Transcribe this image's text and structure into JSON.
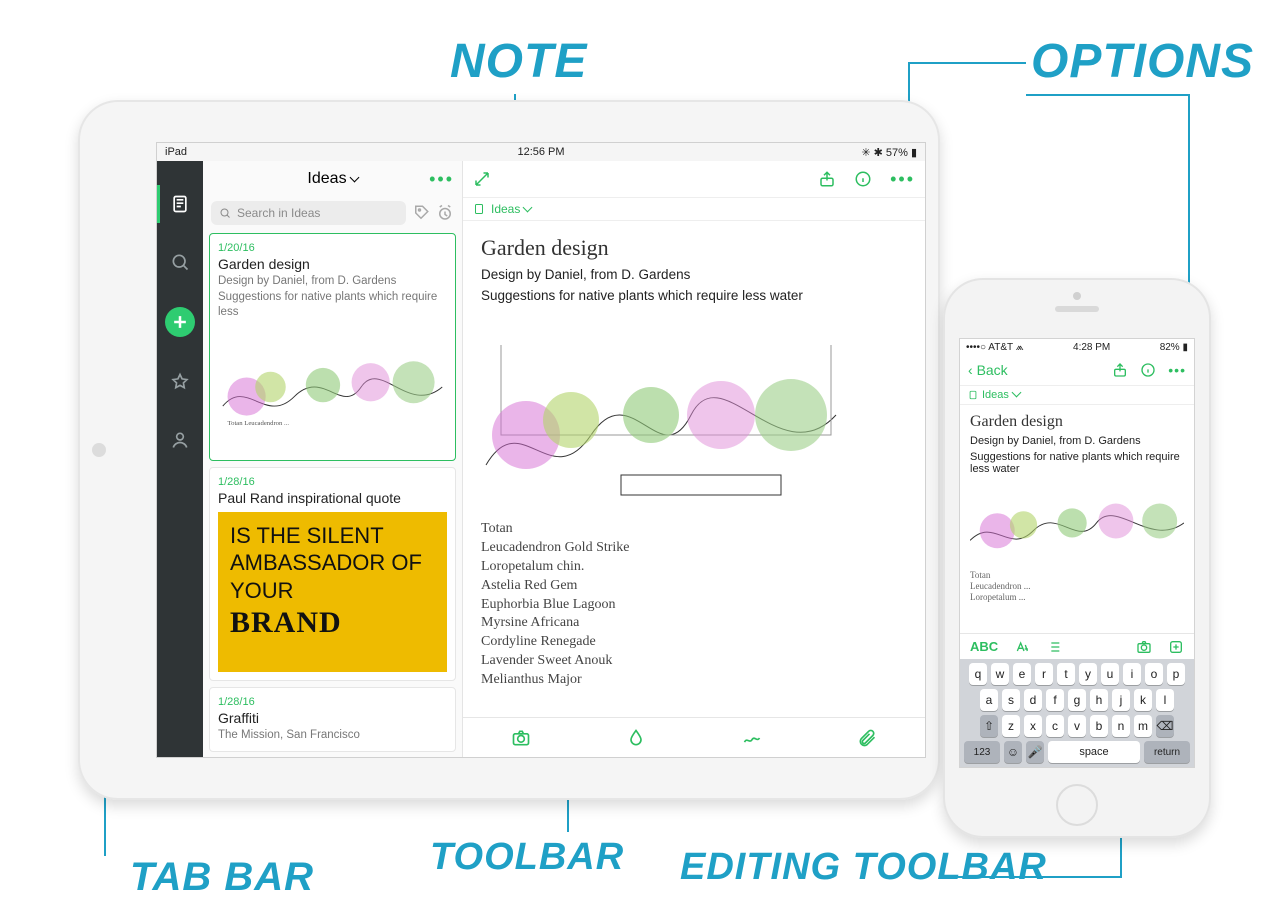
{
  "annotations": {
    "note": "NOTE",
    "options": "OPTIONS",
    "toolbar": "TOOLBAR",
    "editing_toolbar": "EDITING TOOLBAR",
    "tab_bar": "TAB BAR"
  },
  "accent_green": "#2dbe60",
  "accent_blue": "#1fa0c6",
  "ipad": {
    "status": {
      "left": "iPad",
      "center": "12:56 PM",
      "right": "57%"
    },
    "tabbar": {
      "items": [
        "notes-icon",
        "search-icon",
        "add-icon",
        "star-icon",
        "user-icon"
      ],
      "active": "notes-icon"
    },
    "list": {
      "header": "Ideas",
      "search_placeholder": "Search in Ideas",
      "cards": [
        {
          "date": "1/20/16",
          "title": "Garden design",
          "sub": "Design by Daniel, from D. Gardens\nSuggestions for native plants which require less",
          "thumb": "sketch"
        },
        {
          "date": "1/28/16",
          "title": "Paul Rand inspirational quote",
          "quote_l1": "IS THE SILENT AMBASSADOR OF YOUR",
          "quote_l2": "BRAND"
        },
        {
          "date": "1/28/16",
          "title": "Graffiti",
          "sub": "The Mission, San Francisco"
        }
      ]
    },
    "note": {
      "breadcrumb": "Ideas",
      "title": "Garden design",
      "line1": "Design by Daniel, from D. Gardens",
      "line2": "Suggestions for native plants which require less water",
      "handwriting": "Totan\nLeucadendron Gold Strike\nLoropetalum chin.\nAstelia Red Gem\nEuphorbia Blue Lagoon\nMyrsine Africana\nCordyline Renegade\nLavender Sweet Anouk\nMelianthus Major"
    },
    "editor_toolbar": [
      "camera-icon",
      "ink-icon",
      "doodle-icon",
      "attachment-icon"
    ]
  },
  "iphone": {
    "status": {
      "carrier": "AT&T",
      "time": "4:28 PM",
      "battery": "82%"
    },
    "nav": {
      "back": "Back"
    },
    "breadcrumb": "Ideas",
    "note": {
      "title": "Garden design",
      "line1": "Design by Daniel, from D. Gardens",
      "line2": "Suggestions for native plants which require less water"
    },
    "editbar": {
      "left_label": "ABC"
    },
    "keyboard": {
      "row1": [
        "q",
        "w",
        "e",
        "r",
        "t",
        "y",
        "u",
        "i",
        "o",
        "p"
      ],
      "row2": [
        "a",
        "s",
        "d",
        "f",
        "g",
        "h",
        "j",
        "k",
        "l"
      ],
      "row3": [
        "z",
        "x",
        "c",
        "v",
        "b",
        "n",
        "m"
      ],
      "bottom": {
        "num": "123",
        "space": "space",
        "ret": "return"
      }
    }
  }
}
